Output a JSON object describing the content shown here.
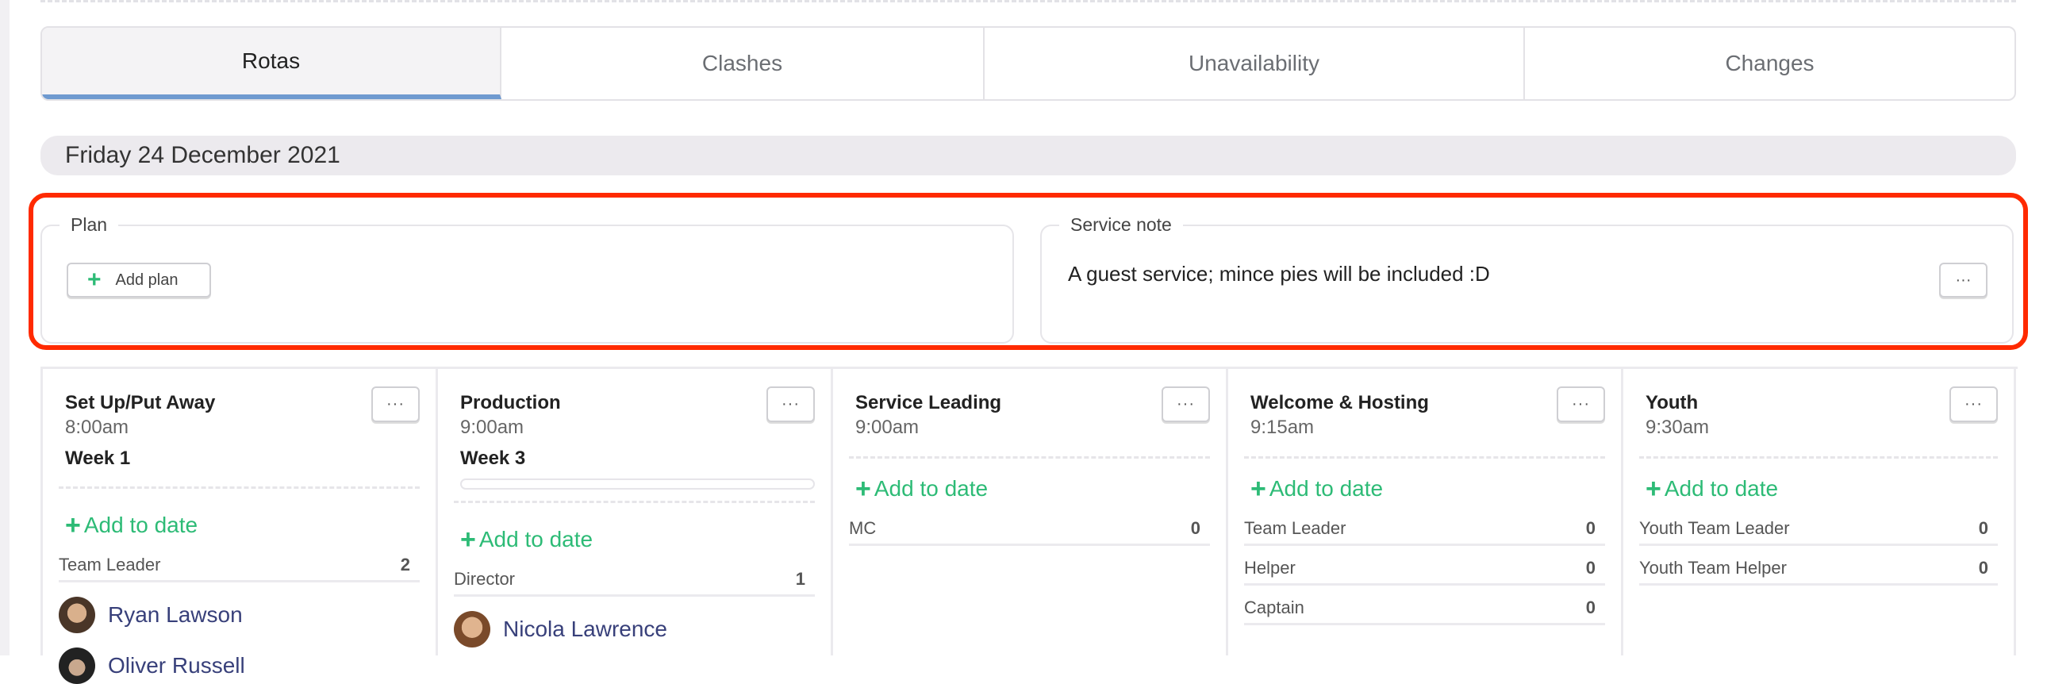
{
  "tabs": [
    {
      "label": "Rotas",
      "active": true
    },
    {
      "label": "Clashes"
    },
    {
      "label": "Unavailability"
    },
    {
      "label": "Changes"
    }
  ],
  "date": "Friday 24 December 2021",
  "plan": {
    "legend": "Plan",
    "add_label": "Add plan"
  },
  "service_note": {
    "legend": "Service note",
    "text": "A guest service; mince pies will be included :D",
    "more": "···"
  },
  "add_to_date": "Add to date",
  "more": "···",
  "columns": [
    {
      "title": "Set Up/Put Away",
      "time": "8:00am",
      "week": "Week 1",
      "roles": [
        {
          "name": "Team Leader",
          "count": "2"
        }
      ],
      "people": [
        "Ryan Lawson",
        "Oliver Russell"
      ]
    },
    {
      "title": "Production",
      "time": "9:00am",
      "week": "Week 3",
      "roles": [
        {
          "name": "Director",
          "count": "1"
        }
      ],
      "people": [
        "Nicola Lawrence"
      ]
    },
    {
      "title": "Service Leading",
      "time": "9:00am",
      "roles": [
        {
          "name": "MC",
          "count": "0"
        }
      ]
    },
    {
      "title": "Welcome & Hosting",
      "time": "9:15am",
      "roles": [
        {
          "name": "Team Leader",
          "count": "0"
        },
        {
          "name": "Helper",
          "count": "0"
        },
        {
          "name": "Captain",
          "count": "0"
        }
      ]
    },
    {
      "title": "Youth",
      "time": "9:30am",
      "roles": [
        {
          "name": "Youth Team Leader",
          "count": "0"
        },
        {
          "name": "Youth Team Helper",
          "count": "0"
        }
      ]
    }
  ]
}
